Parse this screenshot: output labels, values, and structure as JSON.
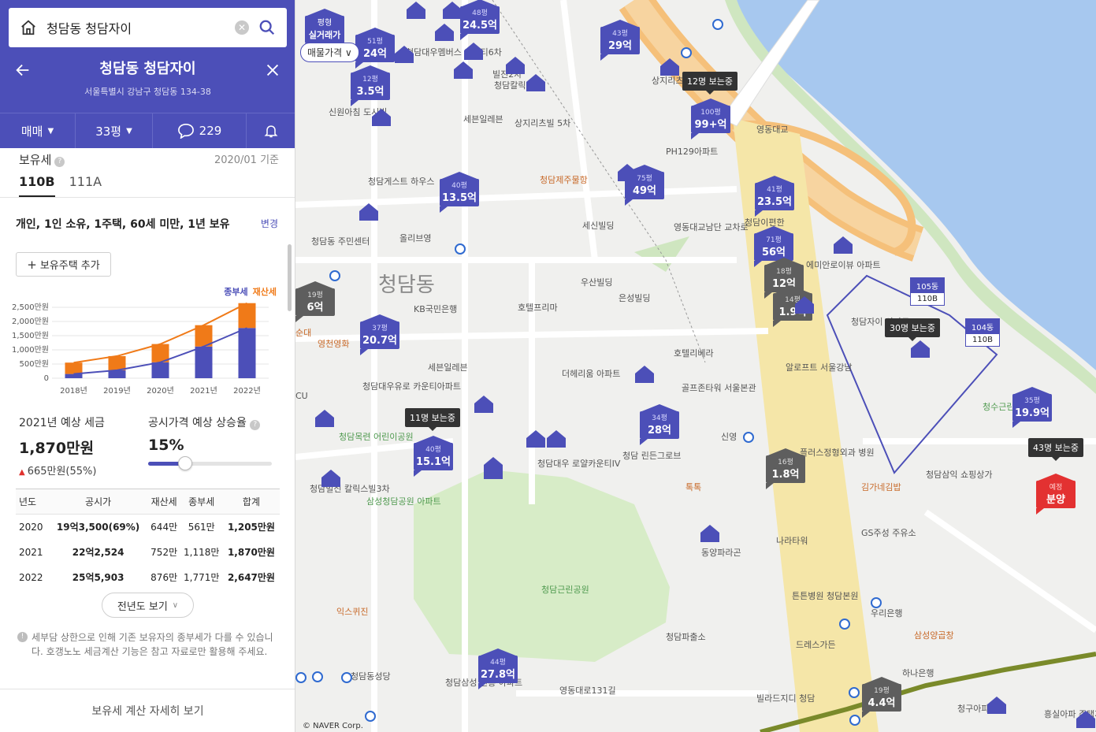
{
  "search": {
    "value": "청담동 청담자이"
  },
  "complex": {
    "title": "청담동 청담자이",
    "address": "서울특별시 강남구 청담동 134-38"
  },
  "tabs": {
    "trade": "매매",
    "size": "33평",
    "comments": "229"
  },
  "tax": {
    "title": "보유세",
    "date": "2020/01 기준",
    "types": [
      "110B",
      "111A"
    ],
    "condition": "개인, 1인 소유, 1주택, 60세 미만, 1년 보유",
    "change": "변경",
    "add_home": "보유주택 추가",
    "legend_a": "종부세",
    "legend_b": "재산세",
    "forecast_label": "2021년 예상 세금",
    "forecast_value": "1,870만원",
    "forecast_diff": "665만원(55%)",
    "rate_label": "공시가격 예상 상승율",
    "rate_value": "15%",
    "rate_fraction": 0.3,
    "more_years": "전년도 보기",
    "notice": "세부담 상한으로 인해 기존 보유자의 종부세가 다를 수 있습니다. 호갱노노 세금계산 기능은 참고 자료로만 활용해 주세요.",
    "detail_link": "보유세 계산 자세히 보기"
  },
  "table": {
    "headers": [
      "년도",
      "공시가",
      "재산세",
      "종부세",
      "합계"
    ],
    "rows": [
      [
        "2020",
        "19억3,500(69%)",
        "644만",
        "561만",
        "1,205만원"
      ],
      [
        "2021",
        "22억2,524",
        "752만",
        "1,118만",
        "1,870만원"
      ],
      [
        "2022",
        "25억5,903",
        "876만",
        "1,771만",
        "2,647만원"
      ]
    ]
  },
  "chart_data": {
    "type": "bar",
    "categories": [
      "2018년",
      "2019년",
      "2020년",
      "2021년",
      "2022년"
    ],
    "series": [
      {
        "name": "종부세",
        "values": [
          150,
          280,
          561,
          1118,
          1771
        ],
        "color": "#4c4fb8"
      },
      {
        "name": "재산세",
        "values": [
          400,
          500,
          644,
          752,
          876
        ],
        "color": "#f07a18"
      }
    ],
    "ylim": [
      0,
      2500
    ],
    "yticks": [
      "0",
      "500만원",
      "1,000만원",
      "1,500만원",
      "2,000만원",
      "2,500만원"
    ],
    "yvalues": [
      0,
      500,
      1000,
      1500,
      2000,
      2500
    ],
    "grid": true
  },
  "map": {
    "price_filter": "매물가격",
    "realtrade_label": "평형",
    "realtrade_sub": "실거래가",
    "copyright": "© NAVER Corp.",
    "district": "청담동",
    "markers": [
      {
        "size": "48평",
        "price": "24.5억",
        "c": "blue"
      },
      {
        "size": "51평",
        "price": "24억",
        "c": "blue"
      },
      {
        "size": "43평",
        "price": "29억",
        "c": "blue"
      },
      {
        "size": "12평",
        "price": "3.5억",
        "c": "blue"
      },
      {
        "size": "100평",
        "price": "99+억",
        "c": "blue"
      },
      {
        "size": "40평",
        "price": "13.5억",
        "c": "blue"
      },
      {
        "size": "75평",
        "price": "49억",
        "c": "blue"
      },
      {
        "size": "41평",
        "price": "23.5억",
        "c": "blue"
      },
      {
        "size": "71평",
        "price": "56억",
        "c": "blue"
      },
      {
        "size": "18평",
        "price": "12억",
        "c": "gray"
      },
      {
        "size": "14평",
        "price": "1.9억",
        "c": "gray"
      },
      {
        "size": "19평",
        "price": "6억",
        "c": "gray"
      },
      {
        "size": "37평",
        "price": "20.7억",
        "c": "blue"
      },
      {
        "size": "40평",
        "price": "15.1억",
        "c": "blue"
      },
      {
        "size": "34평",
        "price": "28억",
        "c": "blue"
      },
      {
        "size": "16평",
        "price": "1.8억",
        "c": "gray"
      },
      {
        "size": "35평",
        "price": "19.9억",
        "c": "blue"
      },
      {
        "size": "44평",
        "price": "27.8억",
        "c": "blue"
      },
      {
        "size": "19평",
        "price": "4.4억",
        "c": "gray"
      },
      {
        "size": "예정",
        "price": "분양",
        "c": "red"
      }
    ],
    "viewers": [
      "12명 보는중",
      "30명 보는중",
      "11명 보는중",
      "43명 보는중"
    ],
    "dongs": [
      {
        "name": "105동",
        "type": "110B"
      },
      {
        "name": "104동",
        "type": "110B"
      }
    ],
    "places": [
      "청담동 주민센터",
      "올리브영",
      "세븐일레븐",
      "상지리츠빌 5차",
      "PH129아파트",
      "영동대교남단 교차로",
      "세신빌딩",
      "청담제주물항",
      "청담게스트 하우스",
      "우산빌딩",
      "은성빌딩",
      "호텔프리마",
      "KB국민은행",
      "호텔리베라",
      "골프존타워 서울본관",
      "알로프트 서울강남",
      "청담자이 아파트",
      "청담삼익 쇼핑상가",
      "김가네김밥",
      "나라타워",
      "GS주성 주유소",
      "청담근린공원",
      "청담파출소",
      "동양파라곤",
      "청담 린든그로브",
      "더헤리움 아파트",
      "청담대우유로 카운티아파트",
      "영천영화",
      "청담목련 어린이공원",
      "청담빌신 칼릭스빌3차",
      "삼성청담공원 아파트",
      "청담대우 로얄카운티IV",
      "익스퀴진",
      "청담동성당",
      "청담삼성 진흥 아파트",
      "영동대로131길",
      "빌라드지디 청담",
      "우리은행",
      "삼성양곱창",
      "드레스가든",
      "튼튼병원 청담본원",
      "하나은행",
      "청구아파트",
      "흥실아파 주택재건",
      "영동대교",
      "신원아침 도시빌",
      "청담칼릭스빌",
      "세븐일레븐",
      "청수근린공",
      "순대",
      "CU",
      "신영",
      "플러스정형외과 병원",
      "톡톡",
      "청담대우멤버스 카운티6차",
      "빌진2차",
      "청담이편한",
      "에미안로이뷰 아파트",
      "상지리츠빌 1차"
    ]
  }
}
